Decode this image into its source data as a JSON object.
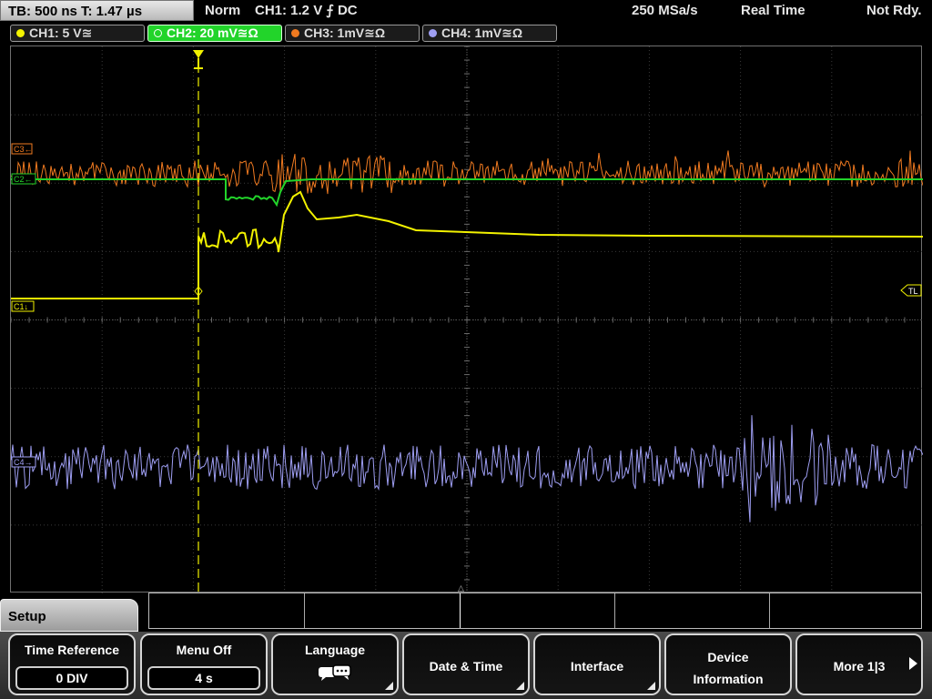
{
  "status": {
    "timebase": "TB: 500 ns  T: 1.47 µs",
    "mode": "Norm",
    "trigger": "CH1: 1.2 V ⨍ DC",
    "sample_rate": "250 MSa/s",
    "acq_mode": "Real Time",
    "state": "Not Rdy."
  },
  "channels": [
    {
      "label": "CH1: 5 V≊",
      "color": "#f2f200"
    },
    {
      "label": "CH2: 20 mV≊Ω",
      "color": "#22d42a"
    },
    {
      "label": "CH3: 1mV≊Ω",
      "color": "#f07a20"
    },
    {
      "label": "CH4: 1mV≊Ω",
      "color": "#9e9ef2"
    }
  ],
  "markers": {
    "c3": "C3←",
    "c2": "C2←",
    "c1": "C1↓",
    "c4": "C4→",
    "trigger_level": "TL"
  },
  "menu": {
    "title": "Setup",
    "softkeys": [
      {
        "label": "Time Reference",
        "value": "0 DIV"
      },
      {
        "label": "Menu Off",
        "value": "4 s"
      },
      {
        "label": "Language",
        "icon": "speech-bubbles-icon"
      },
      {
        "label": "Date & Time"
      },
      {
        "label": "Interface"
      },
      {
        "label_line1": "Device",
        "label_line2": "Information"
      },
      {
        "label": "More 1|3",
        "icon": "right-arrow-icon"
      }
    ]
  }
}
